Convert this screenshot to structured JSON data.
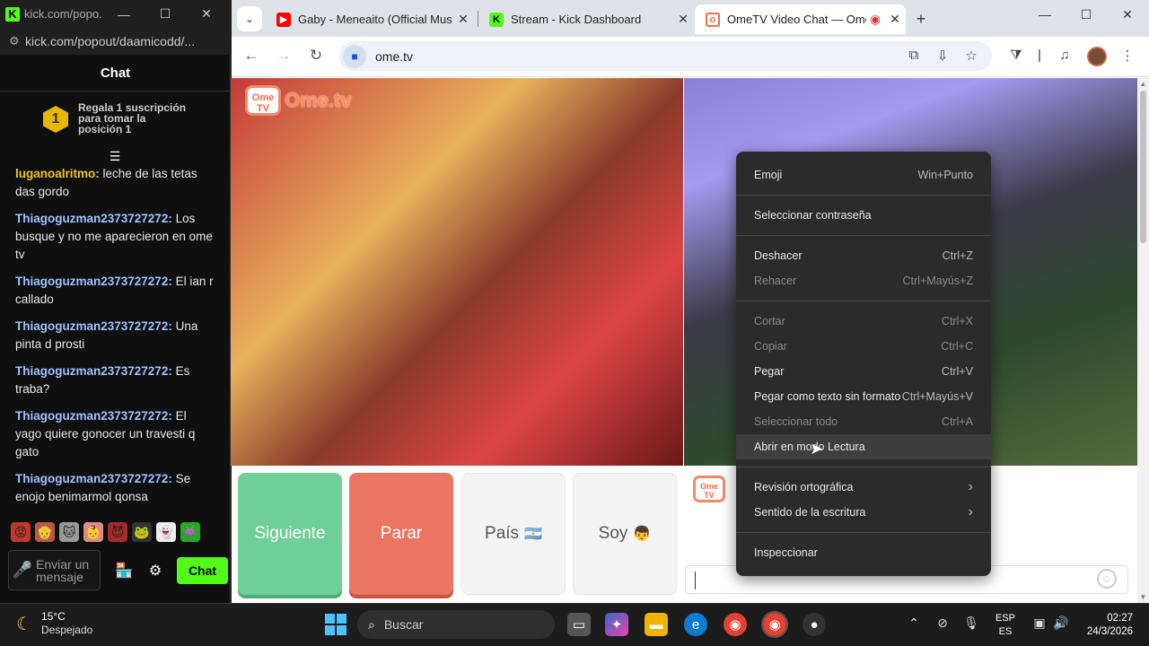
{
  "popout": {
    "title": "kick.com/popo...",
    "url": "kick.com/popout/daamicodd/...",
    "chat_header": "Chat",
    "subscription": {
      "badge": "1",
      "line1": "Regala 1 suscripción",
      "line2": "para tomar la",
      "line3": "posición 1"
    },
    "messages": [
      {
        "user": "luganoalritmo",
        "user_color": "#f0c419",
        "text": " leche de las tetas das gordo"
      },
      {
        "user": "Thiagoguzman2373727272",
        "user_color": "#9ec3ff",
        "text": " Los busque y no me aparecieron en ome tv"
      },
      {
        "user": "Thiagoguzman2373727272",
        "user_color": "#9ec3ff",
        "text": " El ian r callado"
      },
      {
        "user": "Thiagoguzman2373727272",
        "user_color": "#9ec3ff",
        "text": " Una pinta d prosti"
      },
      {
        "user": "Thiagoguzman2373727272",
        "user_color": "#9ec3ff",
        "text": " Es traba?"
      },
      {
        "user": "Thiagoguzman2373727272",
        "user_color": "#9ec3ff",
        "text": " El yago quiere gonocer un travesti q gato"
      },
      {
        "user": "Thiagoguzman2373727272",
        "user_color": "#9ec3ff",
        "text": " Se enojo benimarmol qonsa"
      }
    ],
    "send_placeholder": "Enviar un mensaje",
    "chat_button": "Chat",
    "accent": "#53fc18"
  },
  "browser": {
    "tabs": [
      {
        "title": "Gaby - Meneaito (Official Music",
        "favicon": "youtube-icon"
      },
      {
        "title": "Stream - Kick Dashboard",
        "favicon": "kick-icon"
      },
      {
        "title": "OmeTV Video Chat — Ome",
        "favicon": "ometv-icon"
      }
    ],
    "address": "ome.tv"
  },
  "page": {
    "logo_badge": "Ome TV",
    "logo_text": "Ome.tv",
    "buttons": {
      "next": "Siguiente",
      "stop": "Parar",
      "country": "País",
      "me": "Soy"
    },
    "chat_logo": "Ome TV"
  },
  "context_menu": {
    "items": [
      {
        "label": "Emoji",
        "shortcut": "Win+Punto"
      },
      {
        "label": "Seleccionar contraseña",
        "shortcut": ""
      },
      {
        "label": "Deshacer",
        "shortcut": "Ctrl+Z"
      },
      {
        "label": "Rehacer",
        "shortcut": "Ctrl+Mayús+Z"
      },
      {
        "label": "Cortar",
        "shortcut": "Ctrl+X"
      },
      {
        "label": "Copiar",
        "shortcut": "Ctrl+C"
      },
      {
        "label": "Pegar",
        "shortcut": "Ctrl+V"
      },
      {
        "label": "Pegar como texto sin formato",
        "shortcut": "Ctrl+Mayús+V"
      },
      {
        "label": "Seleccionar todo",
        "shortcut": "Ctrl+A"
      },
      {
        "label": "Abrir en modo Lectura",
        "shortcut": ""
      },
      {
        "label": "Revisión ortográfica",
        "shortcut": "›"
      },
      {
        "label": "Sentido de la escritura",
        "shortcut": "›"
      },
      {
        "label": "Inspeccionar",
        "shortcut": ""
      }
    ]
  },
  "taskbar": {
    "temperature": "15°C",
    "weather": "Despejado",
    "search_placeholder": "Buscar",
    "lang1": "ESP",
    "lang2": "ES",
    "time": "02:27",
    "date": "24/3/2026"
  }
}
